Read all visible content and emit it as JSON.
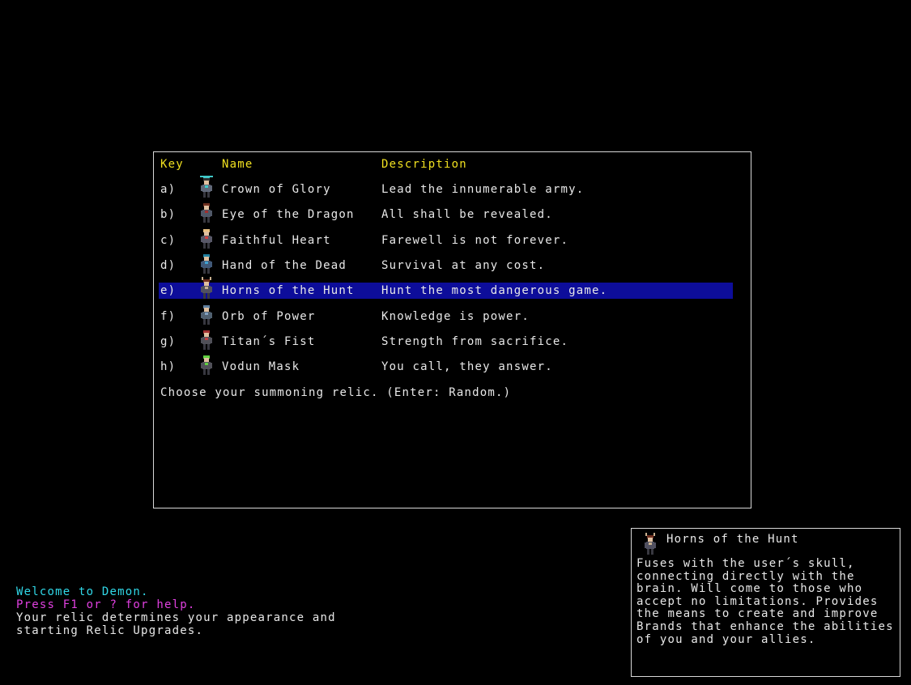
{
  "relic_menu": {
    "headers": {
      "key": "Key",
      "name": "Name",
      "description": "Description"
    },
    "items": [
      {
        "key": "a)",
        "icon": "crown-figure-icon",
        "name": "Crown of Glory",
        "description": "Lead the innumerable army."
      },
      {
        "key": "b)",
        "icon": "eye-figure-icon",
        "name": "Eye of the Dragon",
        "description": "All shall be revealed."
      },
      {
        "key": "c)",
        "icon": "heart-figure-icon",
        "name": "Faithful Heart",
        "description": "Farewell is not forever."
      },
      {
        "key": "d)",
        "icon": "dead-hand-figure-icon",
        "name": "Hand of the Dead",
        "description": "Survival at any cost."
      },
      {
        "key": "e)",
        "icon": "horned-figure-icon",
        "name": "Horns of the Hunt",
        "description": "Hunt the most dangerous game."
      },
      {
        "key": "f)",
        "icon": "orb-figure-icon",
        "name": "Orb of Power",
        "description": "Knowledge is power."
      },
      {
        "key": "g)",
        "icon": "fist-figure-icon",
        "name": "Titan´s Fist",
        "description": "Strength from sacrifice."
      },
      {
        "key": "h)",
        "icon": "mask-figure-icon",
        "name": "Vodun Mask",
        "description": "You call, they answer."
      }
    ],
    "selected_key": "e)",
    "prompt": "Choose your summoning relic. (Enter: Random.)"
  },
  "messages": {
    "welcome": "Welcome to Demon.",
    "help": "Press F1 or ? for help.",
    "info_line1": "Your relic determines your appearance and",
    "info_line2": "starting Relic Upgrades."
  },
  "info_panel": {
    "icon": "horned-figure-icon",
    "title": "Horns of the Hunt",
    "text": "Fuses with the user´s skull,\nconnecting directly with the\nbrain. Will come to those who\naccept no limitations. Provides\nthe means to create and improve\nBrands that enhance the abilities\nof you and your allies."
  },
  "colors": {
    "background": "#000000",
    "header": "#f0e020",
    "selection": "#0d0d9a",
    "welcome": "#30d8e8",
    "help": "#e040e0",
    "text": "#e8e8e8",
    "border": "#d8d8d8"
  }
}
